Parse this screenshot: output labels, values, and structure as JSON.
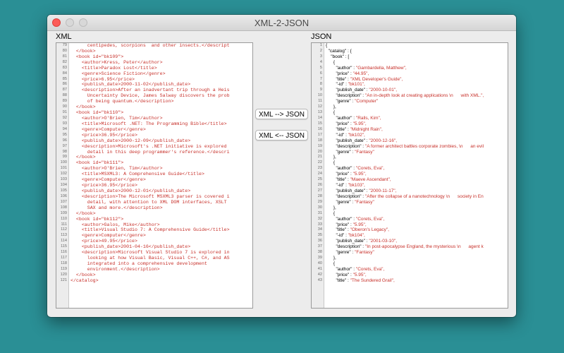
{
  "window": {
    "title": "XML-2-JSON"
  },
  "xml_label": "XML",
  "json_label": "JSON",
  "buttons": {
    "to_json": "XML --> JSON",
    "to_xml": "XML <-- JSON"
  },
  "xml_lines": [
    {
      "n": "79",
      "t": "      centipedes, scorpions  and other insects.</descript"
    },
    {
      "n": "80",
      "t": "  </book>"
    },
    {
      "n": "81",
      "t": "  <book id=\"bk109\">"
    },
    {
      "n": "82",
      "t": "    <author>Kress, Peter</author>"
    },
    {
      "n": "83",
      "t": "    <title>Paradox Lost</title>"
    },
    {
      "n": "84",
      "t": "    <genre>Science Fiction</genre>"
    },
    {
      "n": "85",
      "t": "    <price>6.95</price>"
    },
    {
      "n": "86",
      "t": "    <publish_date>2000-11-02</publish_date>"
    },
    {
      "n": "87",
      "t": "    <description>After an inadvertant trip through a Heis"
    },
    {
      "n": "88",
      "t": "      Uncertainty Device, James Salway discovers the prob"
    },
    {
      "n": "89",
      "t": "      of being quantum.</description>"
    },
    {
      "n": "90",
      "t": "  </book>"
    },
    {
      "n": "91",
      "t": "  <book id=\"bk110\">"
    },
    {
      "n": "92",
      "t": "    <author>O'Brien, Tim</author>"
    },
    {
      "n": "93",
      "t": "    <title>Microsoft .NET: The Programming Bible</title>"
    },
    {
      "n": "94",
      "t": "    <genre>Computer</genre>"
    },
    {
      "n": "95",
      "t": "    <price>36.95</price>"
    },
    {
      "n": "96",
      "t": "    <publish_date>2000-12-09</publish_date>"
    },
    {
      "n": "97",
      "t": "    <description>Microsoft's .NET initiative is explored "
    },
    {
      "n": "98",
      "t": "      detail in this deep programmer's reference.</descri"
    },
    {
      "n": "99",
      "t": "  </book>"
    },
    {
      "n": "100",
      "t": "  <book id=\"bk111\">"
    },
    {
      "n": "101",
      "t": "    <author>O'Brien, Tim</author>"
    },
    {
      "n": "102",
      "t": "    <title>MSXML3: A Comprehensive Guide</title>"
    },
    {
      "n": "103",
      "t": "    <genre>Computer</genre>"
    },
    {
      "n": "104",
      "t": "    <price>36.95</price>"
    },
    {
      "n": "105",
      "t": "    <publish_date>2000-12-01</publish_date>"
    },
    {
      "n": "106",
      "t": "    <description>The Microsoft MSXML3 parser is covered i"
    },
    {
      "n": "107",
      "t": "      detail, with attention to XML DOM interfaces, XSLT "
    },
    {
      "n": "108",
      "t": "      SAX and more.</description>"
    },
    {
      "n": "109",
      "t": "  </book>"
    },
    {
      "n": "110",
      "t": "  <book id=\"bk112\">"
    },
    {
      "n": "111",
      "t": "    <author>Galos, Mike</author>"
    },
    {
      "n": "112",
      "t": "    <title>Visual Studio 7: A Comprehensive Guide</title>"
    },
    {
      "n": "113",
      "t": "    <genre>Computer</genre>"
    },
    {
      "n": "114",
      "t": "    <price>49.95</price>"
    },
    {
      "n": "115",
      "t": "    <publish_date>2001-04-16</publish_date>"
    },
    {
      "n": "116",
      "t": "    <description>Microsoft Visual Studio 7 is explored in"
    },
    {
      "n": "117",
      "t": "      looking at how Visual Basic, Visual C++, C#, and AS"
    },
    {
      "n": "118",
      "t": "      integrated into a comprehensive development"
    },
    {
      "n": "119",
      "t": "      environment.</description>"
    },
    {
      "n": "120",
      "t": "  </book>"
    },
    {
      "n": "121",
      "t": "</catalog>"
    }
  ],
  "json_lines": [
    {
      "n": "1",
      "k": "{",
      "v": ""
    },
    {
      "n": "2",
      "k": "  \"catalog\" : {",
      "v": ""
    },
    {
      "n": "3",
      "k": "    \"book\" : [",
      "v": ""
    },
    {
      "n": "4",
      "k": "      {",
      "v": ""
    },
    {
      "n": "5",
      "k": "        \"author\" : ",
      "v": "\"Gambardella, Matthew\","
    },
    {
      "n": "6",
      "k": "        \"price\" : ",
      "v": "\"44.95\","
    },
    {
      "n": "7",
      "k": "        \"title\" : ",
      "v": "\"XML Developer's Guide\","
    },
    {
      "n": "8",
      "k": "        \"-id\" : ",
      "v": "\"bk101\","
    },
    {
      "n": "9",
      "k": "        \"publish_date\" : ",
      "v": "\"2000-10-01\","
    },
    {
      "n": "10",
      "k": "        \"description\" : ",
      "v": "\"An in-depth look at creating applications \\n      with XML.\","
    },
    {
      "n": "11",
      "k": "        \"genre\" : ",
      "v": "\"Computer\""
    },
    {
      "n": "12",
      "k": "      },",
      "v": ""
    },
    {
      "n": "13",
      "k": "      {",
      "v": ""
    },
    {
      "n": "14",
      "k": "        \"author\" : ",
      "v": "\"Ralls, Kim\","
    },
    {
      "n": "15",
      "k": "        \"price\" : ",
      "v": "\"5.95\","
    },
    {
      "n": "16",
      "k": "        \"title\" : ",
      "v": "\"Midnight Rain\","
    },
    {
      "n": "17",
      "k": "        \"-id\" : ",
      "v": "\"bk102\","
    },
    {
      "n": "18",
      "k": "        \"publish_date\" : ",
      "v": "\"2000-12-16\","
    },
    {
      "n": "19",
      "k": "        \"description\" : ",
      "v": "\"A former architect battles corporate zombies, \\n      an evil"
    },
    {
      "n": "20",
      "k": "        \"genre\" : ",
      "v": "\"Fantasy\""
    },
    {
      "n": "21",
      "k": "      },",
      "v": ""
    },
    {
      "n": "22",
      "k": "      {",
      "v": ""
    },
    {
      "n": "23",
      "k": "        \"author\" : ",
      "v": "\"Corets, Eva\","
    },
    {
      "n": "24",
      "k": "        \"price\" : ",
      "v": "\"5.95\","
    },
    {
      "n": "25",
      "k": "        \"title\" : ",
      "v": "\"Maeve Ascendant\","
    },
    {
      "n": "26",
      "k": "        \"-id\" : ",
      "v": "\"bk103\","
    },
    {
      "n": "27",
      "k": "        \"publish_date\" : ",
      "v": "\"2000-11-17\","
    },
    {
      "n": "28",
      "k": "        \"description\" : ",
      "v": "\"After the collapse of a nanotechnology \\n      society in En"
    },
    {
      "n": "29",
      "k": "        \"genre\" : ",
      "v": "\"Fantasy\""
    },
    {
      "n": "30",
      "k": "      },",
      "v": ""
    },
    {
      "n": "31",
      "k": "      {",
      "v": ""
    },
    {
      "n": "32",
      "k": "        \"author\" : ",
      "v": "\"Corets, Eva\","
    },
    {
      "n": "33",
      "k": "        \"price\" : ",
      "v": "\"5.95\","
    },
    {
      "n": "34",
      "k": "        \"title\" : ",
      "v": "\"Oberon's Legacy\","
    },
    {
      "n": "35",
      "k": "        \"-id\" : ",
      "v": "\"bk104\","
    },
    {
      "n": "36",
      "k": "        \"publish_date\" : ",
      "v": "\"2001-03-10\","
    },
    {
      "n": "37",
      "k": "        \"description\" : ",
      "v": "\"In post-apocalypse England, the mysterious \\n      agent k"
    },
    {
      "n": "38",
      "k": "        \"genre\" : ",
      "v": "\"Fantasy\""
    },
    {
      "n": "39",
      "k": "      },",
      "v": ""
    },
    {
      "n": "40",
      "k": "      {",
      "v": ""
    },
    {
      "n": "41",
      "k": "        \"author\" : ",
      "v": "\"Corets, Eva\","
    },
    {
      "n": "42",
      "k": "        \"price\" : ",
      "v": "\"5.95\","
    },
    {
      "n": "43",
      "k": "        \"title\" : ",
      "v": "\"The Sundered Grail\","
    }
  ]
}
